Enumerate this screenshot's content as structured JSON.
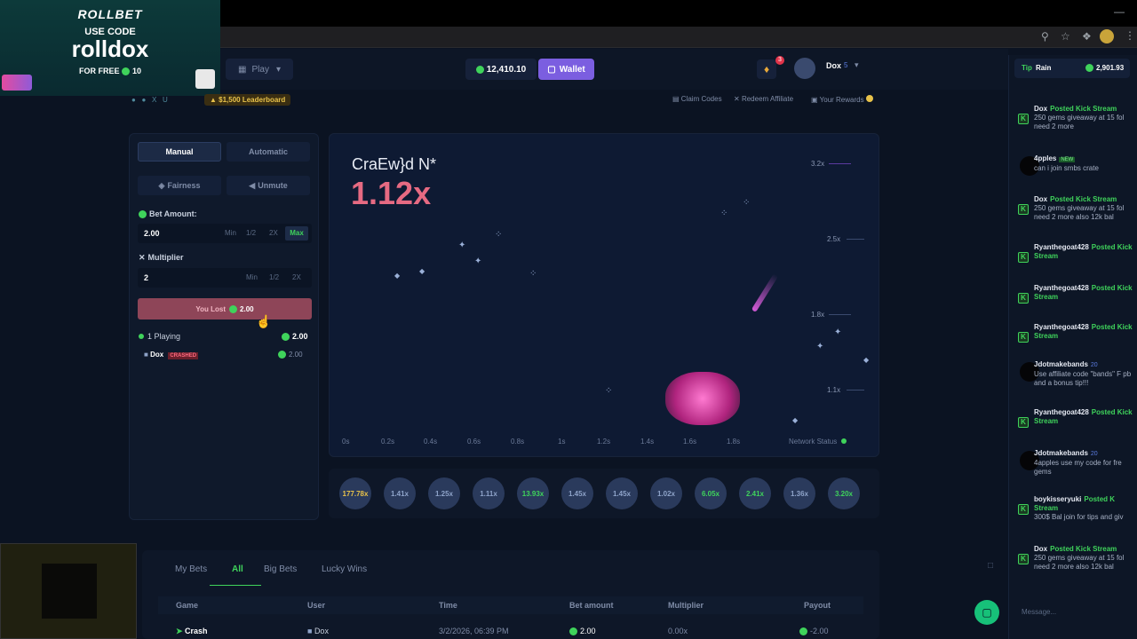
{
  "promo": {
    "brand": "ROLLBET",
    "use_code": "USE CODE",
    "code": "rolldox",
    "free_prefix": "FOR FREE",
    "free_amount": "10"
  },
  "header": {
    "play_label": "Play",
    "balance": "12,410.10",
    "wallet_label": "Wallet",
    "notif_count": "3",
    "username": "Dox",
    "user_level": "5"
  },
  "subnav": {
    "leaderboard": "$1,500 Leaderboard",
    "claim_codes": "Claim Codes",
    "redeem_affiliate": "Redeem Affiliate",
    "your_rewards": "Your Rewards"
  },
  "controls": {
    "tab_manual": "Manual",
    "tab_automatic": "Automatic",
    "fairness": "Fairness",
    "unmute": "Unmute",
    "bet_amount_label": "Bet Amount:",
    "bet_amount_value": "2.00",
    "btn_min": "Min",
    "btn_half": "1/2",
    "btn_2x": "2X",
    "btn_max": "Max",
    "multiplier_label": "Multiplier",
    "multiplier_value": "2",
    "lost_label": "You Lost",
    "lost_amount": "2.00",
    "playing_count": "1 Playing",
    "playing_total": "2.00",
    "player_name": "Dox",
    "player_status": "CRASHED",
    "player_amount": "2.00"
  },
  "game": {
    "crashed_text": "CraEw}d N*",
    "multiplier": "1.12x",
    "y_labels": [
      "3.2x",
      "2.5x",
      "1.8x",
      "1.1x"
    ],
    "x_ticks": [
      "0s",
      "0.2s",
      "0.4s",
      "0.6s",
      "0.8s",
      "1s",
      "1.2s",
      "1.4s",
      "1.6s",
      "1.8s"
    ],
    "network_status": "Network Status"
  },
  "history": [
    {
      "v": "177.78x",
      "c": "#e8c24a"
    },
    {
      "v": "1.41x",
      "c": "#8ea3c9"
    },
    {
      "v": "1.25x",
      "c": "#8ea3c9"
    },
    {
      "v": "1.11x",
      "c": "#8ea3c9"
    },
    {
      "v": "13.93x",
      "c": "#3fd35b"
    },
    {
      "v": "1.45x",
      "c": "#8ea3c9"
    },
    {
      "v": "1.45x",
      "c": "#8ea3c9"
    },
    {
      "v": "1.02x",
      "c": "#8ea3c9"
    },
    {
      "v": "6.05x",
      "c": "#3fd35b"
    },
    {
      "v": "2.41x",
      "c": "#3fd35b"
    },
    {
      "v": "1.36x",
      "c": "#8ea3c9"
    },
    {
      "v": "3.20x",
      "c": "#3fd35b"
    }
  ],
  "bets": {
    "tabs": [
      "My Bets",
      "All",
      "Big Bets",
      "Lucky Wins"
    ],
    "columns": [
      "Game",
      "User",
      "Time",
      "Bet amount",
      "Multiplier",
      "Payout"
    ],
    "row": {
      "game": "Crash",
      "user": "Dox",
      "time": "3/2/2026, 06:39 PM",
      "bet": "2.00",
      "multiplier": "0.00x",
      "payout": "-2.00"
    }
  },
  "chat": {
    "tip_label": "Tip",
    "rain_label": "Rain",
    "rain_amount": "2,901.93",
    "placeholder": "Message...",
    "messages": [
      {
        "name": "Dox",
        "posted": "Posted Kick Stream",
        "text": "250 gems giveaway at 15 fol need 2 more"
      },
      {
        "name": "4pples",
        "badge": "NEW",
        "text": "can i join smbs crate"
      },
      {
        "name": "Dox",
        "posted": "Posted Kick Stream",
        "text": "250 gems giveaway at 15 fol need 2 more also 12k bal"
      },
      {
        "name": "Ryanthegoat428",
        "posted": "Posted Kick Stream",
        "text": ""
      },
      {
        "name": "Ryanthegoat428",
        "posted": "Posted Kick Stream",
        "text": ""
      },
      {
        "name": "Ryanthegoat428",
        "posted": "Posted Kick Stream",
        "text": ""
      },
      {
        "name": "Jdotmakebands",
        "level": "20",
        "text": "Use affiliate code \"bands\" F pb and a bonus tip!!!"
      },
      {
        "name": "Ryanthegoat428",
        "posted": "Posted Kick Stream",
        "text": ""
      },
      {
        "name": "Jdotmakebands",
        "level": "20",
        "text": "4apples use my code for fre gems"
      },
      {
        "name": "boykisseryuki",
        "posted": "Posted K Stream",
        "text": "300$ Bal join for tips and giv"
      },
      {
        "name": "Dox",
        "posted": "Posted Kick Stream",
        "text": "250 gems giveaway at 15 fol need 2 more also 12k bal"
      }
    ]
  }
}
